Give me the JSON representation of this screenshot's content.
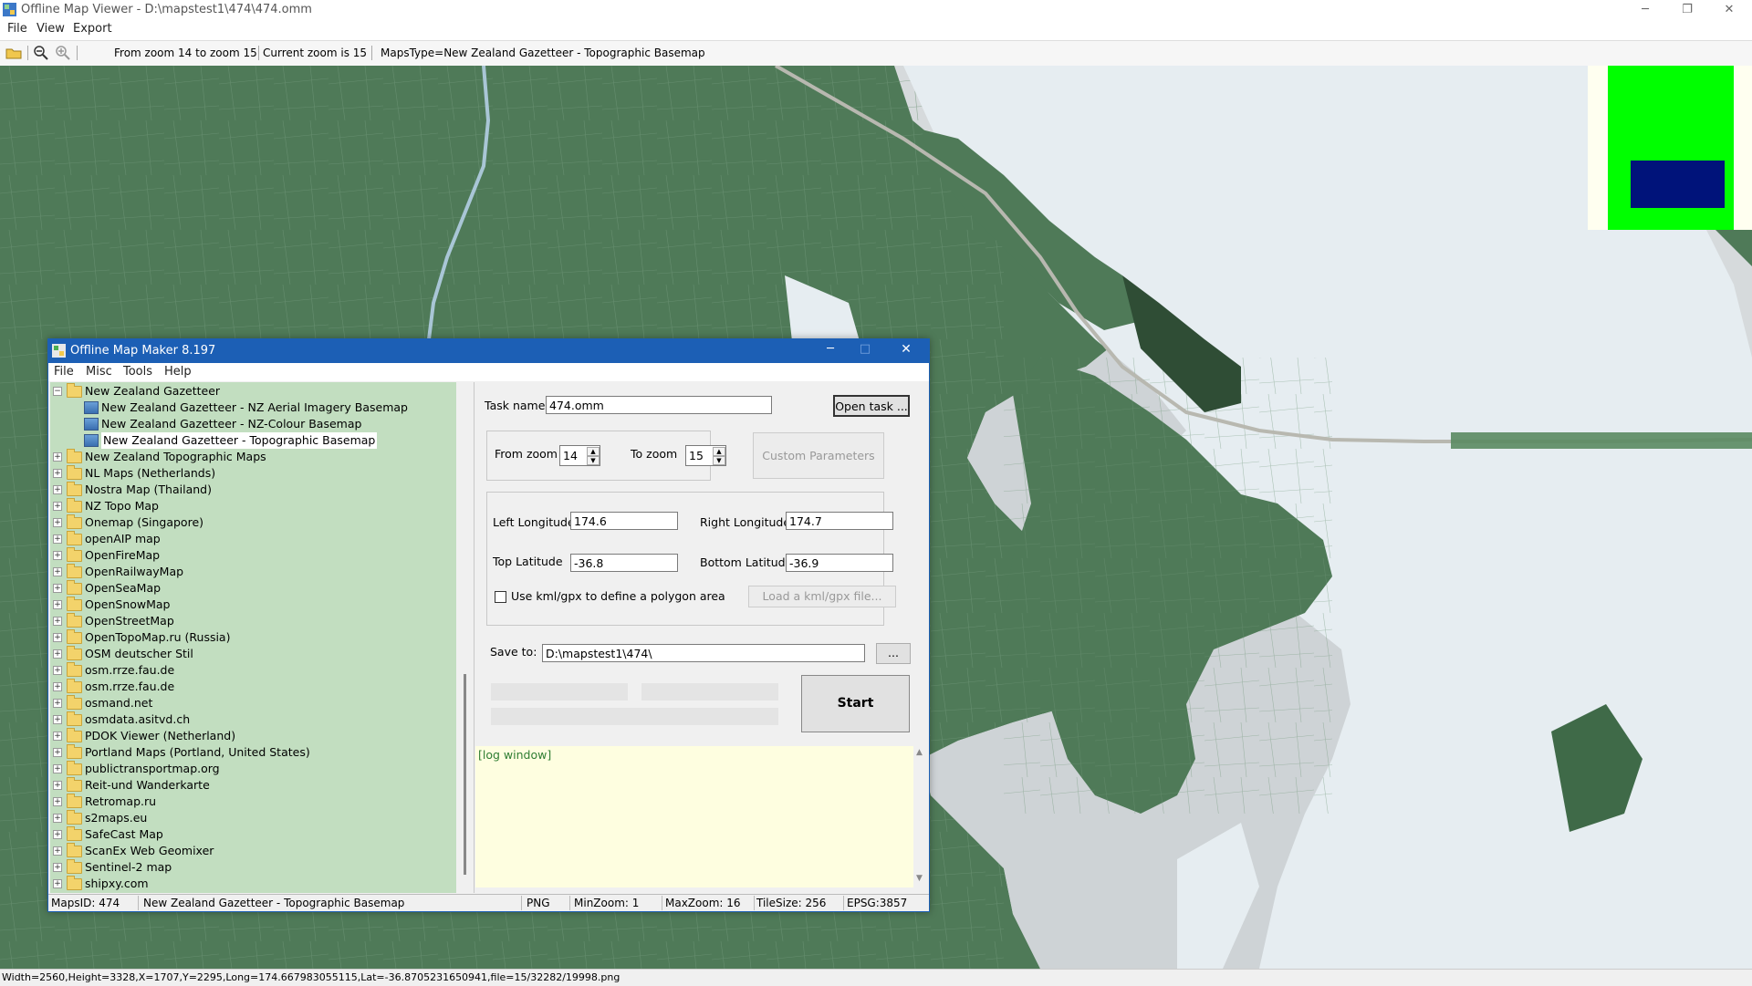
{
  "app": {
    "title": "Offline Map Viewer - D:\\mapstest1\\474\\474.omm",
    "menu": [
      "File",
      "View",
      "Export"
    ]
  },
  "toolbar": {
    "zoom_range": "From zoom 14 to zoom 15",
    "current_zoom": "Current zoom is 15",
    "maps_type": "MapsType=New Zealand Gazetteer - Topographic Basemap"
  },
  "statusbar": {
    "text": "Width=2560,Height=3328,X=1707,Y=2295,Long=174.667983055115,Lat=-36.8705231650941,file=15/32282/19998.png"
  },
  "dialog": {
    "title": "Offline Map Maker 8.197",
    "menu": [
      "File",
      "Misc",
      "Tools",
      "Help"
    ],
    "tree": [
      {
        "label": "New Zealand Gazetteer",
        "level": 0,
        "expanded": true,
        "type": "folder-open"
      },
      {
        "label": "New Zealand Gazetteer - NZ Aerial Imagery Basemap",
        "level": 1,
        "type": "map"
      },
      {
        "label": "New Zealand Gazetteer - NZ-Colour Basemap",
        "level": 1,
        "type": "map"
      },
      {
        "label": "New Zealand Gazetteer - Topographic Basemap",
        "level": 1,
        "type": "map",
        "selected": true
      },
      {
        "label": "New Zealand Topographic Maps",
        "level": 0,
        "type": "folder"
      },
      {
        "label": "NL Maps (Netherlands)",
        "level": 0,
        "type": "folder"
      },
      {
        "label": "Nostra Map (Thailand)",
        "level": 0,
        "type": "folder"
      },
      {
        "label": "NZ Topo Map",
        "level": 0,
        "type": "folder"
      },
      {
        "label": "Onemap (Singapore)",
        "level": 0,
        "type": "folder"
      },
      {
        "label": "openAIP map",
        "level": 0,
        "type": "folder"
      },
      {
        "label": "OpenFireMap",
        "level": 0,
        "type": "folder"
      },
      {
        "label": "OpenRailwayMap",
        "level": 0,
        "type": "folder"
      },
      {
        "label": "OpenSeaMap",
        "level": 0,
        "type": "folder"
      },
      {
        "label": "OpenSnowMap",
        "level": 0,
        "type": "folder"
      },
      {
        "label": "OpenStreetMap",
        "level": 0,
        "type": "folder"
      },
      {
        "label": "OpenTopoMap.ru (Russia)",
        "level": 0,
        "type": "folder"
      },
      {
        "label": "OSM deutscher Stil",
        "level": 0,
        "type": "folder"
      },
      {
        "label": "osm.rrze.fau.de",
        "level": 0,
        "type": "folder"
      },
      {
        "label": "osm.rrze.fau.de",
        "level": 0,
        "type": "folder"
      },
      {
        "label": "osmand.net",
        "level": 0,
        "type": "folder"
      },
      {
        "label": "osmdata.asitvd.ch",
        "level": 0,
        "type": "folder"
      },
      {
        "label": "PDOK Viewer (Netherland)",
        "level": 0,
        "type": "folder"
      },
      {
        "label": "Portland Maps (Portland, United States)",
        "level": 0,
        "type": "folder"
      },
      {
        "label": "publictransportmap.org",
        "level": 0,
        "type": "folder"
      },
      {
        "label": "Reit-und Wanderkarte",
        "level": 0,
        "type": "folder"
      },
      {
        "label": "Retromap.ru",
        "level": 0,
        "type": "folder"
      },
      {
        "label": "s2maps.eu",
        "level": 0,
        "type": "folder"
      },
      {
        "label": "SafeCast Map",
        "level": 0,
        "type": "folder"
      },
      {
        "label": "ScanEx Web Geomixer",
        "level": 0,
        "type": "folder"
      },
      {
        "label": "Sentinel-2 map",
        "level": 0,
        "type": "folder"
      },
      {
        "label": "shipxy.com",
        "level": 0,
        "type": "folder"
      }
    ],
    "task_name_label": "Task name",
    "task_name_value": "474.omm",
    "open_task": "Open task ...",
    "from_zoom_label": "From zoom",
    "from_zoom_value": "14",
    "to_zoom_label": "To zoom",
    "to_zoom_value": "15",
    "custom_params": "Custom Parameters",
    "left_lon_label": "Left Longitude",
    "left_lon_value": "174.6",
    "right_lon_label": "Right Longitude",
    "right_lon_value": "174.7",
    "top_lat_label": "Top Latitude",
    "top_lat_value": "-36.8",
    "bottom_lat_label": "Bottom Latitude",
    "bottom_lat_value": "-36.9",
    "kml_checkbox_label": "Use kml/gpx to define a polygon area",
    "kml_checked": false,
    "load_kml": "Load a kml/gpx file...",
    "save_to_label": "Save to:",
    "save_to_value": "D:\\mapstest1\\474\\",
    "browse": "...",
    "start": "Start",
    "log_text": "[log window]",
    "status": {
      "maps_id": "MapsID: 474",
      "map_name": "New Zealand Gazetteer - Topographic Basemap",
      "format": "PNG",
      "min_zoom": "MinZoom: 1",
      "max_zoom": "MaxZoom: 16",
      "tile_size": "TileSize: 256",
      "epsg": "EPSG:3857"
    }
  },
  "colors": {
    "map_land": "#4f7a58",
    "map_land_dark": "#3f6a48",
    "map_water": "#e6edf1",
    "map_mud": "#ced3d6",
    "tree_bg": "#c2dec0",
    "dialog_title": "#1c5fb5",
    "log_bg": "#fefee0",
    "overview_green": "#00ff00",
    "overview_navy": "#00137a"
  }
}
